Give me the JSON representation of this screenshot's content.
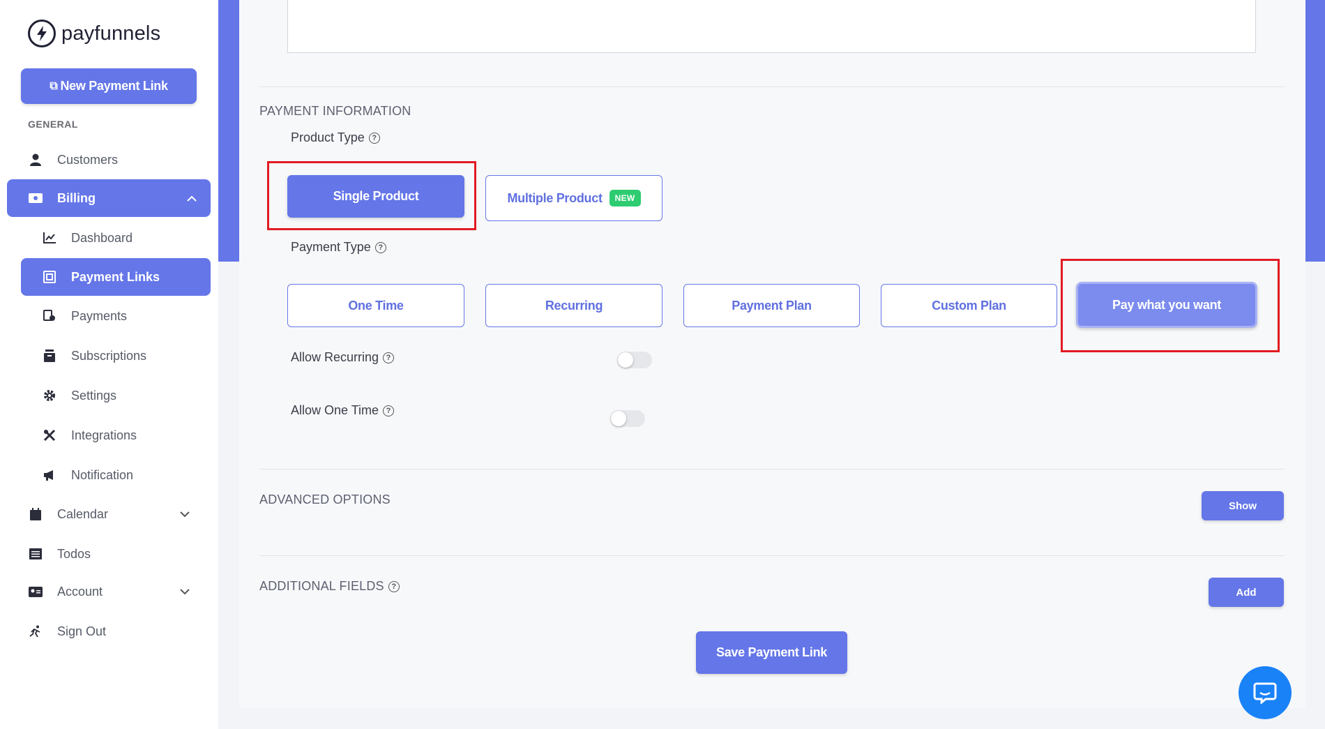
{
  "brand": {
    "name": "payfunnels"
  },
  "sidebar": {
    "new_link_label": "New Payment Link",
    "section_general": "GENERAL",
    "items": {
      "customers": "Customers",
      "billing": "Billing",
      "dashboard": "Dashboard",
      "payment_links": "Payment Links",
      "payments": "Payments",
      "subscriptions": "Subscriptions",
      "settings": "Settings",
      "integrations": "Integrations",
      "notification": "Notification",
      "calendar": "Calendar",
      "todos": "Todos",
      "account": "Account",
      "sign_out": "Sign Out"
    }
  },
  "payment_info": {
    "section_title": "PAYMENT INFORMATION",
    "product_type_label": "Product Type",
    "single_product": "Single Product",
    "multiple_product": "Multiple Product",
    "new_badge": "NEW",
    "payment_type_label": "Payment Type",
    "payment_types": {
      "one_time": "One Time",
      "recurring": "Recurring",
      "payment_plan": "Payment Plan",
      "custom_plan": "Custom Plan",
      "pay_what_you_want": "Pay what you want"
    },
    "allow_recurring_label": "Allow Recurring",
    "allow_one_time_label": "Allow One Time"
  },
  "advanced": {
    "title": "ADVANCED OPTIONS",
    "show_label": "Show"
  },
  "additional": {
    "title": "ADDITIONAL FIELDS",
    "add_label": "Add"
  },
  "save_label": "Save Payment Link",
  "help_glyph": "?"
}
